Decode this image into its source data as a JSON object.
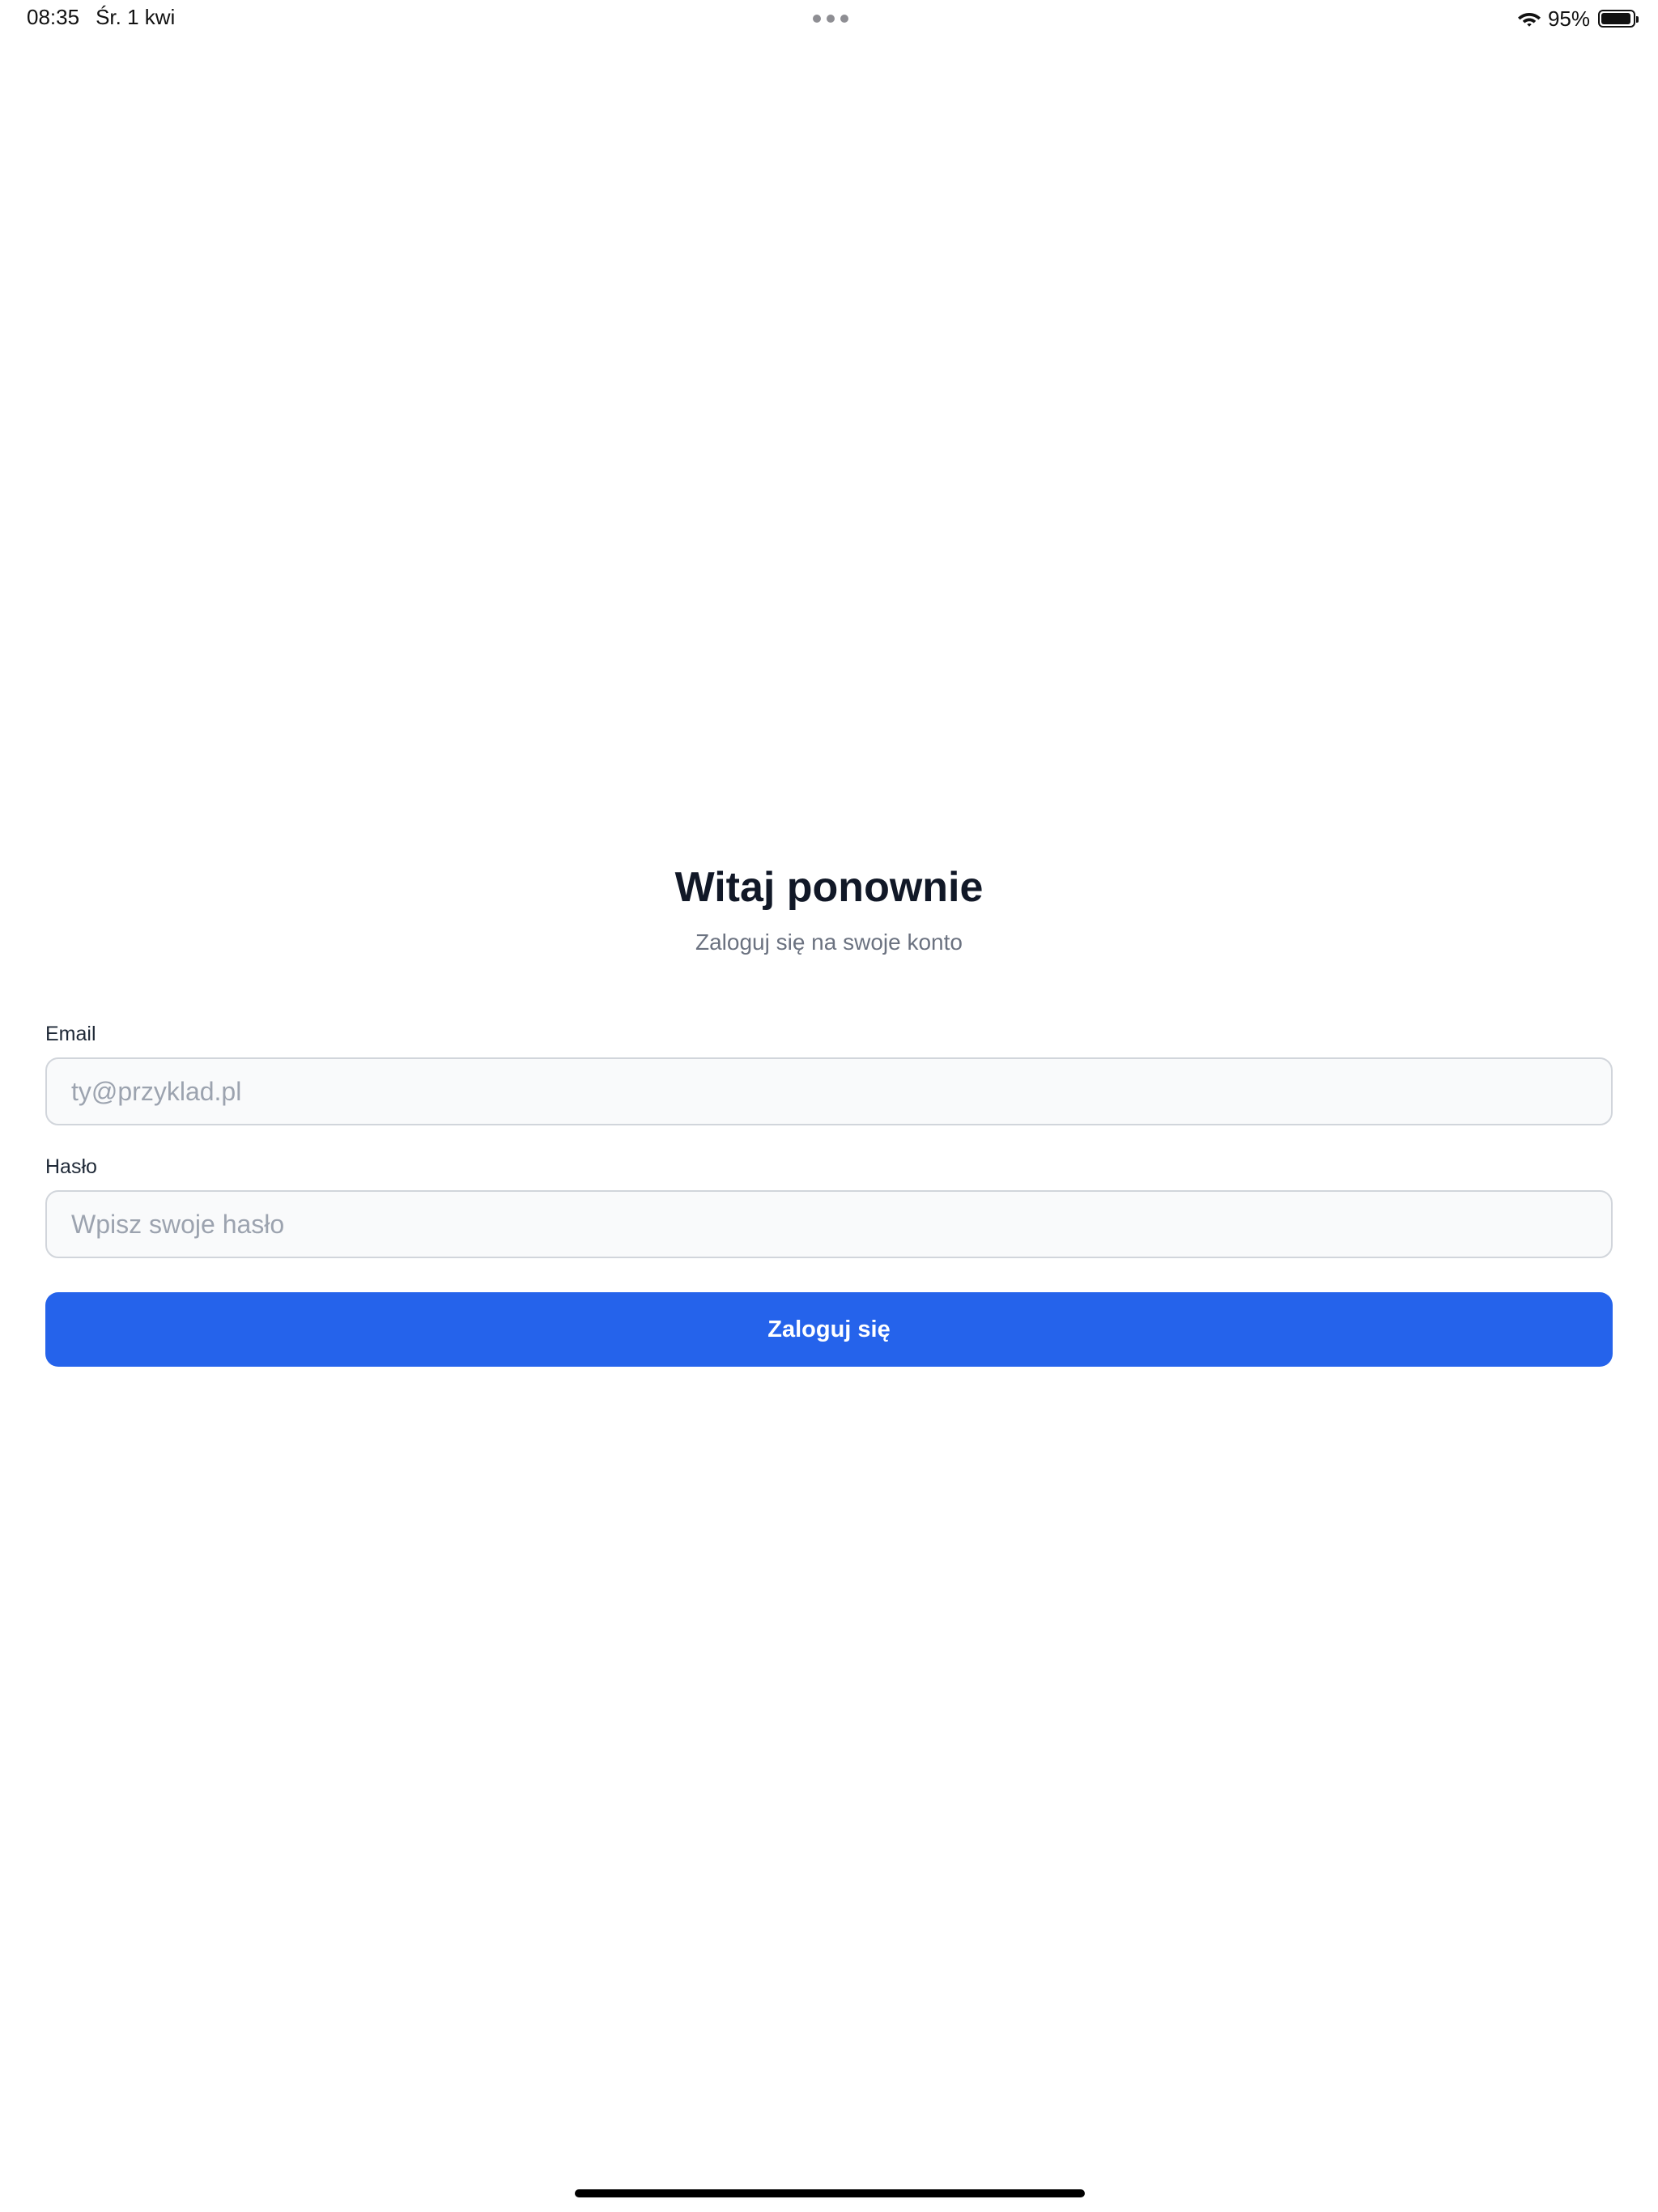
{
  "status_bar": {
    "time": "08:35",
    "date": "Śr. 1 kwi",
    "battery_percent_label": "95%",
    "battery_level": 0.95,
    "icons": [
      "wifi-icon",
      "battery-icon",
      "multitask-dots-icon"
    ]
  },
  "login": {
    "title": "Witaj ponownie",
    "subtitle": "Zaloguj się na swoje konto",
    "email": {
      "label": "Email",
      "value": "",
      "placeholder": "ty@przyklad.pl"
    },
    "password": {
      "label": "Hasło",
      "value": "",
      "placeholder": "Wpisz swoje hasło"
    },
    "submit_label": "Zaloguj się"
  },
  "colors": {
    "accent": "#2563eb",
    "title_text": "#111827",
    "subtitle_text": "#6b7280",
    "input_background": "#f9fafb",
    "input_border": "#d1d5db",
    "placeholder_text": "#9ca3af"
  }
}
